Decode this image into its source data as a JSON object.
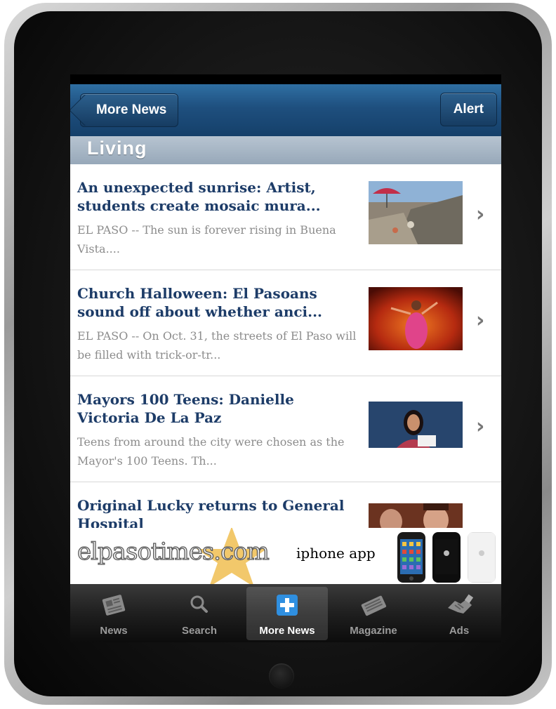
{
  "nav": {
    "back_label": "More News",
    "alert_label": "Alert"
  },
  "section_title": "Living",
  "articles": [
    {
      "title": "An unexpected sunrise: Artist, students create mosaic mura...",
      "summary": "EL PASO -- The sun is forever rising in Buena Vista...."
    },
    {
      "title": "Church  Halloween: El Pasoans sound off about whether anci...",
      "summary": "EL PASO -- On Oct. 31, the streets of El Paso will be filled with trick-or-tr..."
    },
    {
      "title": "Mayors 100 Teens: Danielle Victoria De La Paz",
      "summary": "Teens from around the city were chosen as the Mayor's 100 Teens. Th..."
    },
    {
      "title": "Original Lucky returns to General Hospital",
      "summary": ""
    }
  ],
  "ad": {
    "site": "elpasotimes.com",
    "text": "iphone app"
  },
  "tabs": [
    {
      "label": "News",
      "icon": "newspaper-icon",
      "selected": false
    },
    {
      "label": "Search",
      "icon": "search-icon",
      "selected": false
    },
    {
      "label": "More News",
      "icon": "plus-icon",
      "selected": true
    },
    {
      "label": "Magazine",
      "icon": "magazine-icon",
      "selected": false
    },
    {
      "label": "Ads",
      "icon": "handshake-icon",
      "selected": false
    }
  ],
  "colors": {
    "navbar": "#1e4f7e",
    "headline": "#1d3c68",
    "summary": "#8c8c8c",
    "tab_selected": "#2f8fe0"
  }
}
